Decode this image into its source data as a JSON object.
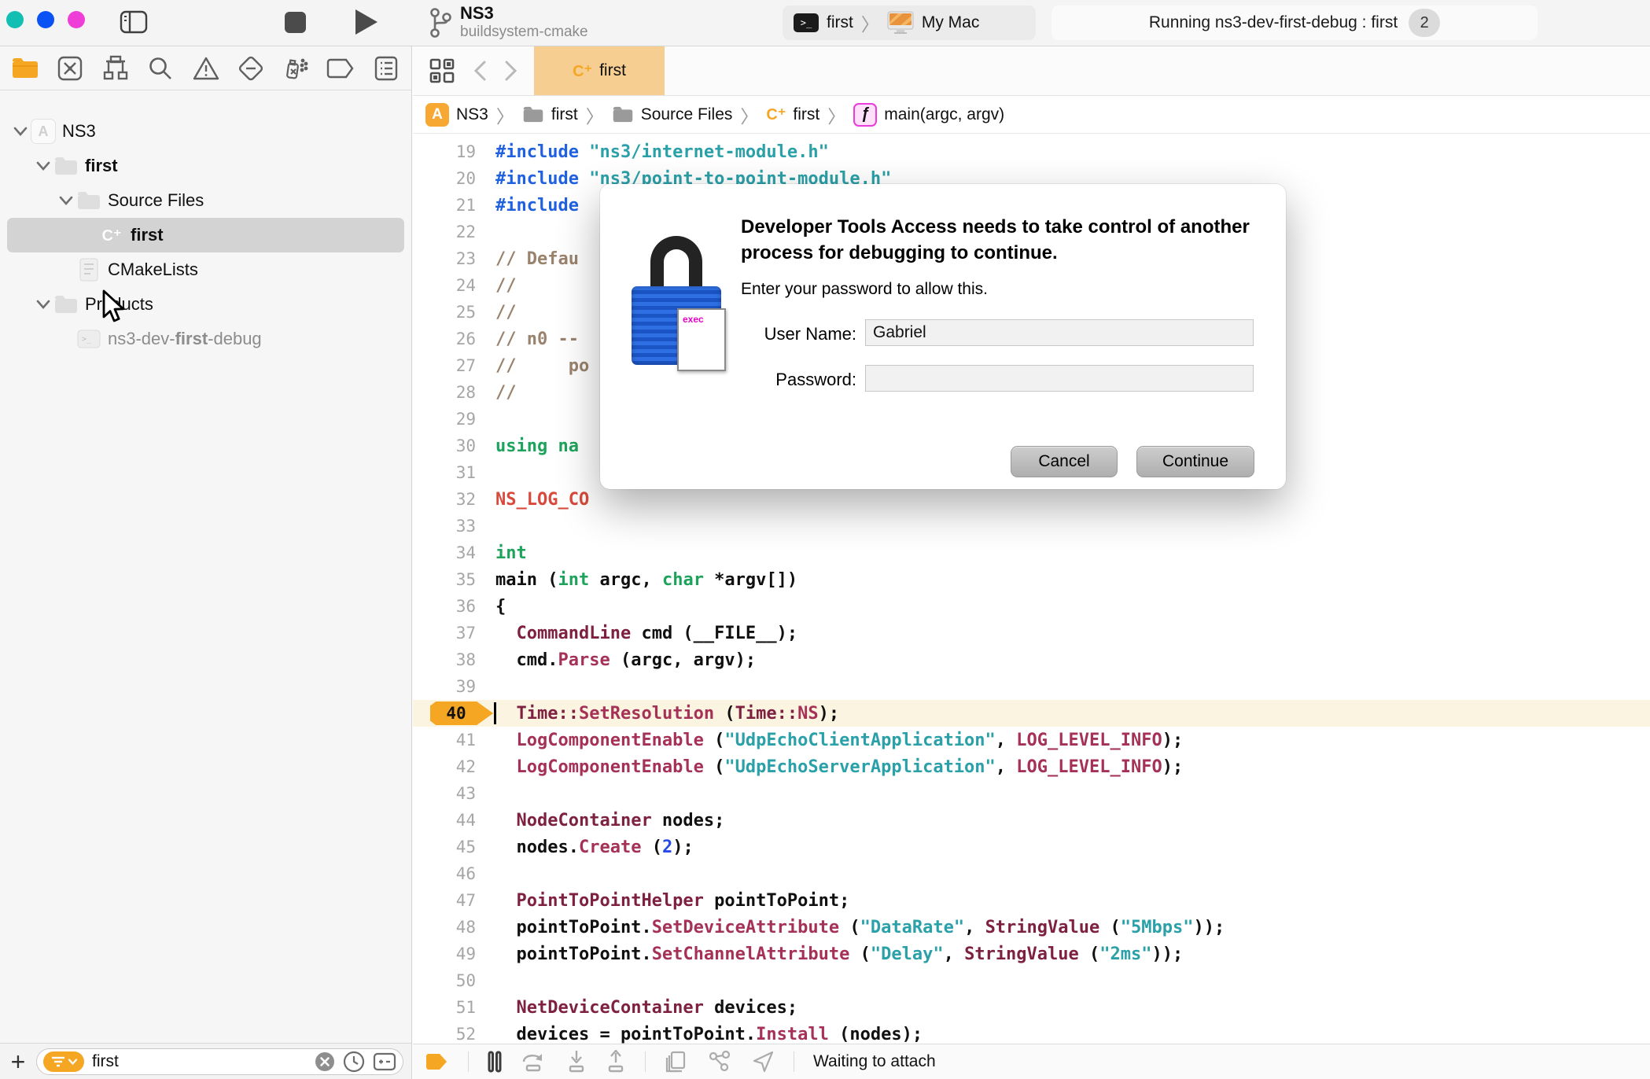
{
  "toolbar": {
    "project_title": "NS3",
    "project_subtitle": "buildsystem-cmake",
    "scheme": "first",
    "run_destination": "My Mac",
    "status_text": "Running ns3-dev-first-debug : first",
    "status_badge": "2"
  },
  "traffic_colors": {
    "close": "#12BFB2",
    "minimize": "#0B52F5",
    "zoom": "#EE3ED7"
  },
  "navigator": {
    "tree": [
      {
        "depth": 0,
        "icon": "app",
        "expand": true,
        "label": [
          [
            "NS3",
            0
          ]
        ]
      },
      {
        "depth": 1,
        "icon": "folder",
        "expand": true,
        "label": [
          [
            "first",
            1
          ]
        ]
      },
      {
        "depth": 2,
        "icon": "folder",
        "expand": true,
        "label": [
          [
            "Source Files",
            0
          ]
        ]
      },
      {
        "depth": 3,
        "icon": "cpp",
        "selected": true,
        "label": [
          [
            "first",
            1
          ]
        ]
      },
      {
        "depth": 2,
        "icon": "doc",
        "label": [
          [
            "CMakeLists",
            0
          ]
        ]
      },
      {
        "depth": 1,
        "icon": "folder",
        "expand": true,
        "label": [
          [
            "Products",
            0
          ]
        ]
      },
      {
        "depth": 2,
        "icon": "term",
        "dim": true,
        "label": [
          [
            "ns3-dev-",
            0
          ],
          [
            "first",
            1
          ],
          [
            "-debug",
            0
          ]
        ]
      }
    ],
    "filter_value": "first"
  },
  "tab": {
    "label": "first",
    "glyph": "C⁺"
  },
  "jumpbar": [
    {
      "icon": "appbadge",
      "label": "NS3"
    },
    {
      "icon": "folder",
      "label": "first"
    },
    {
      "icon": "folder",
      "label": "Source Files"
    },
    {
      "icon": "cpp",
      "label": "first"
    },
    {
      "icon": "func",
      "label": "main(argc, argv)"
    }
  ],
  "dialog": {
    "title": "Developer Tools Access needs to take control of another process for debugging to continue.",
    "subtitle": "Enter your password to allow this.",
    "username_label": "User Name:",
    "username_value": "Gabriel",
    "password_label": "Password:",
    "password_value": "",
    "cancel_label": "Cancel",
    "continue_label": "Continue",
    "lock_badge": "exec"
  },
  "debugbar": {
    "status": "Waiting to attach"
  },
  "code": {
    "current_line": 40,
    "colors": {
      "pre": "#2061DF",
      "str": "#2AA0A8",
      "cmt": "#99836D",
      "kw": "#1DA35B",
      "ty": "#7E2140",
      "fn": "#A63157",
      "mac": "#D8493C",
      "num": "#2749E8",
      "pl": "#101010"
    },
    "lines": [
      {
        "n": 19,
        "seg": [
          [
            "#include ",
            "pre"
          ],
          [
            "\"ns3/internet-module.h\"",
            "str"
          ]
        ]
      },
      {
        "n": 20,
        "seg": [
          [
            "#include ",
            "pre"
          ],
          [
            "\"ns3/point-to-point-module.h\"",
            "str"
          ]
        ]
      },
      {
        "n": 21,
        "seg": [
          [
            "#include",
            "pre"
          ]
        ]
      },
      {
        "n": 22,
        "seg": []
      },
      {
        "n": 23,
        "seg": [
          [
            "// Defau",
            "cmt"
          ]
        ]
      },
      {
        "n": 24,
        "seg": [
          [
            "//",
            "cmt"
          ]
        ]
      },
      {
        "n": 25,
        "seg": [
          [
            "//",
            "cmt"
          ]
        ]
      },
      {
        "n": 26,
        "seg": [
          [
            "// n0 --",
            "cmt"
          ]
        ]
      },
      {
        "n": 27,
        "seg": [
          [
            "//     po",
            "cmt"
          ]
        ]
      },
      {
        "n": 28,
        "seg": [
          [
            "//",
            "cmt"
          ]
        ]
      },
      {
        "n": 29,
        "seg": []
      },
      {
        "n": 30,
        "seg": [
          [
            "using",
            "kw"
          ],
          [
            " ",
            "pl"
          ],
          [
            "na",
            "kw"
          ]
        ]
      },
      {
        "n": 31,
        "seg": []
      },
      {
        "n": 32,
        "seg": [
          [
            "NS_LOG_CO",
            "mac"
          ]
        ]
      },
      {
        "n": 33,
        "seg": []
      },
      {
        "n": 34,
        "seg": [
          [
            "int",
            "kw"
          ]
        ]
      },
      {
        "n": 35,
        "seg": [
          [
            "main (",
            "pl"
          ],
          [
            "int",
            "kw"
          ],
          [
            " argc, ",
            "pl"
          ],
          [
            "char",
            "kw"
          ],
          [
            " *argv[])",
            "pl"
          ]
        ]
      },
      {
        "n": 36,
        "seg": [
          [
            "{",
            "pl"
          ]
        ]
      },
      {
        "n": 37,
        "seg": [
          [
            "  ",
            "pl"
          ],
          [
            "CommandLine",
            "ty"
          ],
          [
            " cmd (__FILE__);",
            "pl"
          ]
        ]
      },
      {
        "n": 38,
        "seg": [
          [
            "  cmd.",
            "pl"
          ],
          [
            "Parse",
            "fn"
          ],
          [
            " (argc, argv);",
            "pl"
          ]
        ]
      },
      {
        "n": 39,
        "seg": []
      },
      {
        "n": 40,
        "seg": [
          [
            "  ",
            "pl"
          ],
          [
            "Time",
            "ty"
          ],
          [
            "::",
            "ty"
          ],
          [
            "SetResolution",
            "fn"
          ],
          [
            " (",
            "pl"
          ],
          [
            "Time",
            "ty"
          ],
          [
            "::",
            "ty"
          ],
          [
            "NS",
            "fn"
          ],
          [
            ");",
            "pl"
          ]
        ]
      },
      {
        "n": 41,
        "seg": [
          [
            "  ",
            "pl"
          ],
          [
            "LogComponentEnable",
            "fn"
          ],
          [
            " (",
            "pl"
          ],
          [
            "\"UdpEchoClientApplication\"",
            "str"
          ],
          [
            ", ",
            "pl"
          ],
          [
            "LOG_LEVEL_INFO",
            "fn"
          ],
          [
            ");",
            "pl"
          ]
        ]
      },
      {
        "n": 42,
        "seg": [
          [
            "  ",
            "pl"
          ],
          [
            "LogComponentEnable",
            "fn"
          ],
          [
            " (",
            "pl"
          ],
          [
            "\"UdpEchoServerApplication\"",
            "str"
          ],
          [
            ", ",
            "pl"
          ],
          [
            "LOG_LEVEL_INFO",
            "fn"
          ],
          [
            ");",
            "pl"
          ]
        ]
      },
      {
        "n": 43,
        "seg": []
      },
      {
        "n": 44,
        "seg": [
          [
            "  ",
            "pl"
          ],
          [
            "NodeContainer",
            "ty"
          ],
          [
            " nodes;",
            "pl"
          ]
        ]
      },
      {
        "n": 45,
        "seg": [
          [
            "  nodes.",
            "pl"
          ],
          [
            "Create",
            "fn"
          ],
          [
            " (",
            "pl"
          ],
          [
            "2",
            "num"
          ],
          [
            ");",
            "pl"
          ]
        ]
      },
      {
        "n": 46,
        "seg": []
      },
      {
        "n": 47,
        "seg": [
          [
            "  ",
            "pl"
          ],
          [
            "PointToPointHelper",
            "ty"
          ],
          [
            " pointToPoint;",
            "pl"
          ]
        ]
      },
      {
        "n": 48,
        "seg": [
          [
            "  pointToPoint.",
            "pl"
          ],
          [
            "SetDeviceAttribute",
            "fn"
          ],
          [
            " (",
            "pl"
          ],
          [
            "\"DataRate\"",
            "str"
          ],
          [
            ", ",
            "pl"
          ],
          [
            "StringValue",
            "ty"
          ],
          [
            " (",
            "pl"
          ],
          [
            "\"5Mbps\"",
            "str"
          ],
          [
            "));",
            "pl"
          ]
        ]
      },
      {
        "n": 49,
        "seg": [
          [
            "  pointToPoint.",
            "pl"
          ],
          [
            "SetChannelAttribute",
            "fn"
          ],
          [
            " (",
            "pl"
          ],
          [
            "\"Delay\"",
            "str"
          ],
          [
            ", ",
            "pl"
          ],
          [
            "StringValue",
            "ty"
          ],
          [
            " (",
            "pl"
          ],
          [
            "\"2ms\"",
            "str"
          ],
          [
            "));",
            "pl"
          ]
        ]
      },
      {
        "n": 50,
        "seg": []
      },
      {
        "n": 51,
        "seg": [
          [
            "  ",
            "pl"
          ],
          [
            "NetDeviceContainer",
            "ty"
          ],
          [
            " devices;",
            "pl"
          ]
        ]
      },
      {
        "n": 52,
        "seg": [
          [
            "  devices = pointToPoint.",
            "pl"
          ],
          [
            "Install",
            "fn"
          ],
          [
            " (nodes);",
            "pl"
          ]
        ]
      }
    ]
  }
}
